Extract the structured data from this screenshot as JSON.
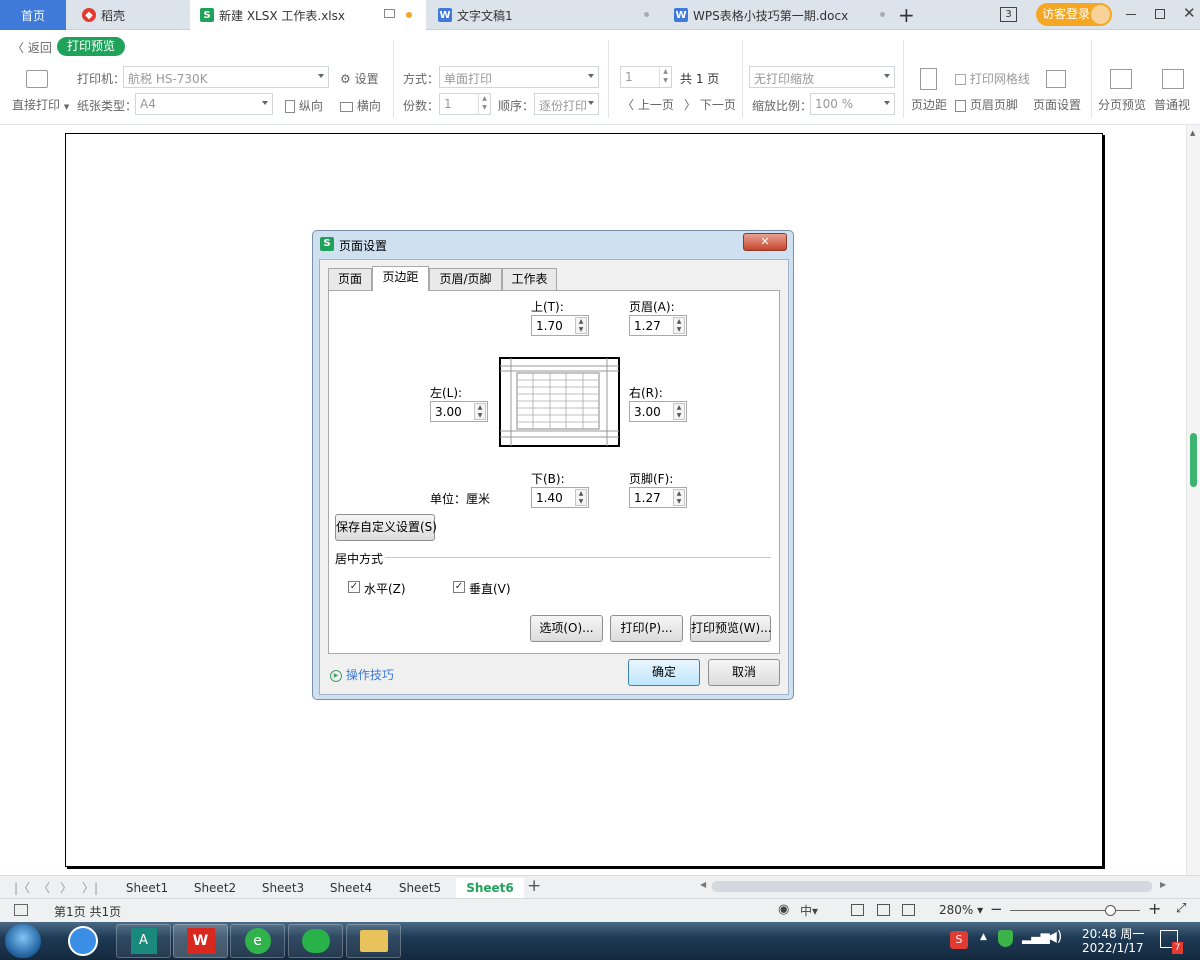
{
  "tabs": [
    {
      "label": "首页"
    },
    {
      "label": "稻壳"
    },
    {
      "label": "新建 XLSX 工作表.xlsx"
    },
    {
      "label": "文字文稿1"
    },
    {
      "label": "WPS表格小技巧第一期.docx"
    }
  ],
  "tabbar": {
    "badge": "3",
    "login": "访客登录"
  },
  "header": {
    "back": "返回",
    "mode": "打印预览"
  },
  "toolbar": {
    "direct_print": "直接打印",
    "printer_label": "打印机：",
    "printer_value": "航税 HS-730K",
    "settings": "设置",
    "paper_label": "纸张类型：",
    "paper_value": "A4",
    "portrait": "纵向",
    "landscape": "横向",
    "method_label": "方式：",
    "method_value": "单面打印",
    "copies_label": "份数：",
    "copies_value": "1",
    "order_label": "顺序：",
    "order_value": "逐份打印",
    "page_value": "1",
    "total_pages": "共 1 页",
    "prev_page": "上一页",
    "next_page": "下一页",
    "scale_value": "无打印缩放",
    "zoom_label": "缩放比例：",
    "zoom_value": "100 %",
    "margins": "页边距",
    "gridlines": "打印网格线",
    "header_footer": "页眉页脚",
    "page_setup": "页面设置",
    "page_break": "分页预览",
    "normal": "普通视"
  },
  "dialog": {
    "title": "页面设置",
    "tabs": [
      "页面",
      "页边距",
      "页眉/页脚",
      "工作表"
    ],
    "top_label": "上(T):",
    "top_value": "1.70",
    "header_label": "页眉(A):",
    "header_value": "1.27",
    "left_label": "左(L):",
    "left_value": "3.00",
    "right_label": "右(R):",
    "right_value": "3.00",
    "bottom_label": "下(B):",
    "bottom_value": "1.40",
    "footer_label": "页脚(F):",
    "footer_value": "1.27",
    "unit": "单位：厘米",
    "save_custom": "保存自定义设置(S)",
    "center_title": "居中方式",
    "horizontal": "水平(Z)",
    "vertical": "垂直(V)",
    "options": "选项(O)...",
    "print": "打印(P)...",
    "preview": "打印预览(W)...",
    "tips": "操作技巧",
    "ok": "确定",
    "cancel": "取消"
  },
  "sheets": [
    "Sheet1",
    "Sheet2",
    "Sheet3",
    "Sheet4",
    "Sheet5",
    "Sheet6"
  ],
  "status": {
    "page_info": "第1页 共1页",
    "zoom": "280%"
  },
  "clock": {
    "time": "20:48 周一",
    "date": "2022/1/17"
  },
  "tray": {
    "notif_count": "7"
  },
  "colors": {
    "accent_green": "#1fa35b",
    "login_orange": "#f5a623",
    "tab_blue": "#3f7ad9"
  }
}
